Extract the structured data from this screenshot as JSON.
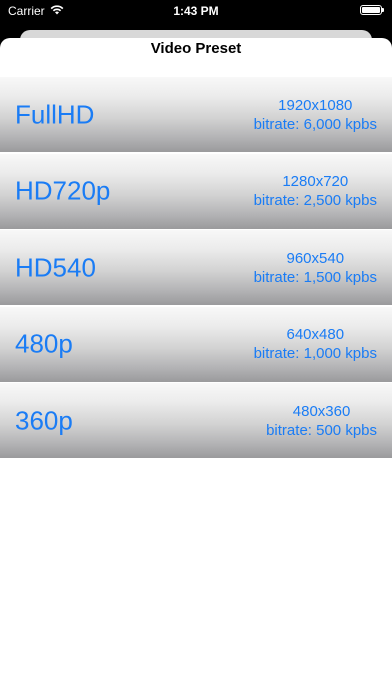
{
  "status_bar": {
    "carrier": "Carrier",
    "time": "1:43 PM",
    "wifi_icon": "wifi-icon",
    "battery_icon": "battery-icon"
  },
  "sheet": {
    "title": "Video Preset"
  },
  "presets": [
    {
      "name": "FullHD",
      "resolution": "1920x1080",
      "bitrate": "bitrate: 6,000 kpbs"
    },
    {
      "name": "HD720p",
      "resolution": "1280x720",
      "bitrate": "bitrate: 2,500 kpbs"
    },
    {
      "name": "HD540",
      "resolution": "960x540",
      "bitrate": "bitrate: 1,500 kpbs"
    },
    {
      "name": "480p",
      "resolution": "640x480",
      "bitrate": "bitrate: 1,000 kpbs"
    },
    {
      "name": "360p",
      "resolution": "480x360",
      "bitrate": "bitrate: 500 kpbs"
    }
  ],
  "colors": {
    "accent": "#1a7cf5",
    "background": "#000000",
    "sheet": "#ffffff"
  }
}
